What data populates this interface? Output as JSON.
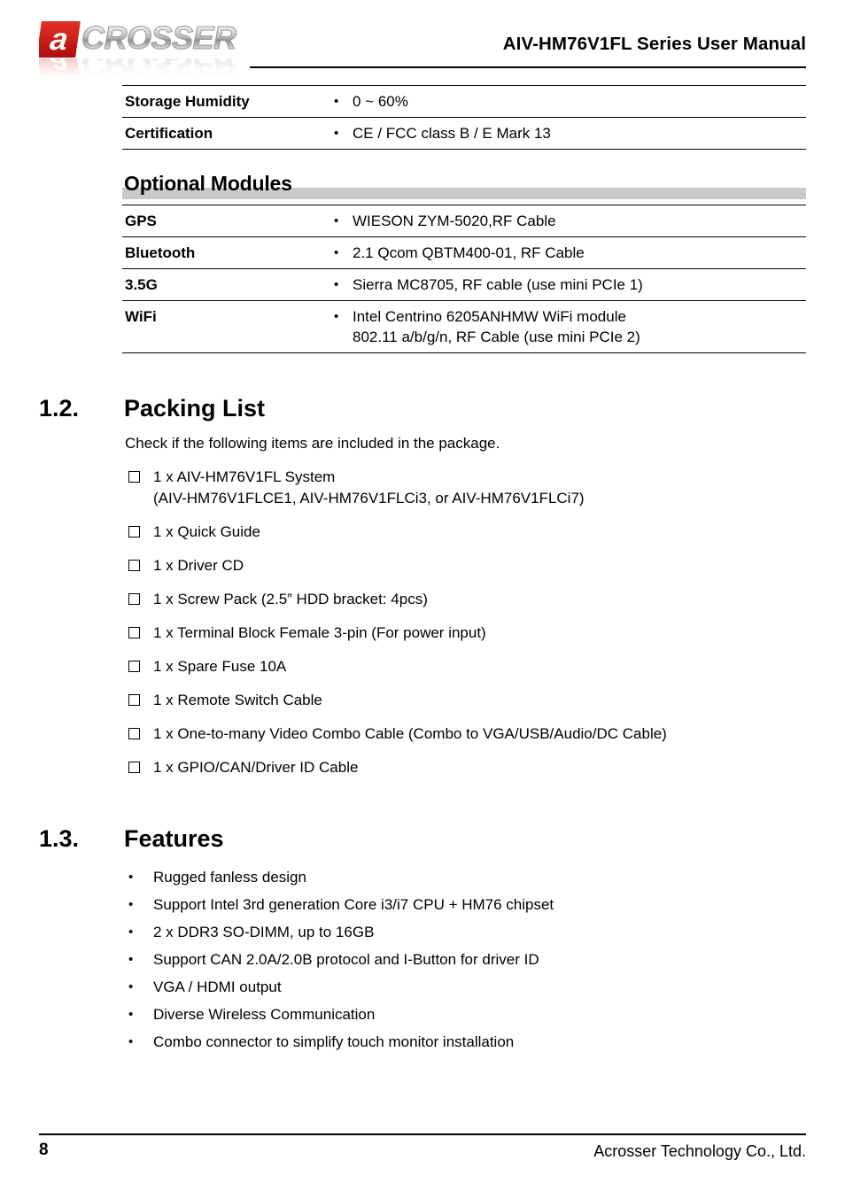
{
  "header": {
    "logo_mark_letter": "a",
    "logo_word": "CROSSER",
    "title": "AIV-HM76V1FL Series User Manual",
    "brand_red": "#d0201b",
    "brand_gray": "#b9b9b9"
  },
  "spec_table_top": {
    "rows": [
      {
        "label": "Storage Humidity",
        "value": "0 ~ 60%"
      },
      {
        "label": "Certification",
        "value": "CE / FCC class B / E Mark 13"
      }
    ]
  },
  "optional_modules": {
    "heading": "Optional Modules",
    "bar_color": "#c9c9c9",
    "rows": [
      {
        "label": "GPS",
        "value": "WIESON ZYM-5020,RF Cable",
        "value_line2": ""
      },
      {
        "label": "Bluetooth",
        "value": "2.1 Qcom QBTM400-01, RF Cable",
        "value_line2": ""
      },
      {
        "label": "3.5G",
        "value": "Sierra MC8705, RF cable (use mini PCIe 1)",
        "value_line2": ""
      },
      {
        "label": "WiFi",
        "value": "Intel Centrino 6205ANHMW WiFi module",
        "value_line2": "802.11 a/b/g/n, RF Cable (use mini PCIe 2)"
      }
    ]
  },
  "packing_list": {
    "number": "1.2.",
    "title": "Packing List",
    "intro": "Check if the following items are included in the package.",
    "items": [
      {
        "line1": "1 x AIV-HM76V1FL System",
        "line2": "(AIV-HM76V1FLCE1, AIV-HM76V1FLCi3, or AIV-HM76V1FLCi7)"
      },
      {
        "line1": "1 x Quick Guide",
        "line2": ""
      },
      {
        "line1": "1 x Driver CD",
        "line2": ""
      },
      {
        "line1": "1 x Screw Pack (2.5” HDD bracket: 4pcs)",
        "line2": ""
      },
      {
        "line1": "1 x Terminal Block Female 3-pin (For power input)",
        "line2": ""
      },
      {
        "line1": "1 x Spare Fuse 10A",
        "line2": ""
      },
      {
        "line1": "1 x Remote Switch Cable",
        "line2": ""
      },
      {
        "line1": "1 x One-to-many Video Combo Cable (Combo to VGA/USB/Audio/DC Cable)",
        "line2": ""
      },
      {
        "line1": "1 x GPIO/CAN/Driver ID Cable",
        "line2": ""
      }
    ]
  },
  "features": {
    "number": "1.3.",
    "title": "Features",
    "items": [
      "Rugged fanless design",
      "Support Intel 3rd generation Core i3/i7 CPU + HM76 chipset",
      "2 x DDR3 SO-DIMM, up to 16GB",
      "Support CAN 2.0A/2.0B protocol and I-Button for driver ID",
      "VGA / HDMI output",
      "Diverse Wireless Communication",
      "Combo connector to simplify touch monitor installation"
    ]
  },
  "footer": {
    "page_number": "8",
    "company": "Acrosser Technology Co., Ltd."
  }
}
